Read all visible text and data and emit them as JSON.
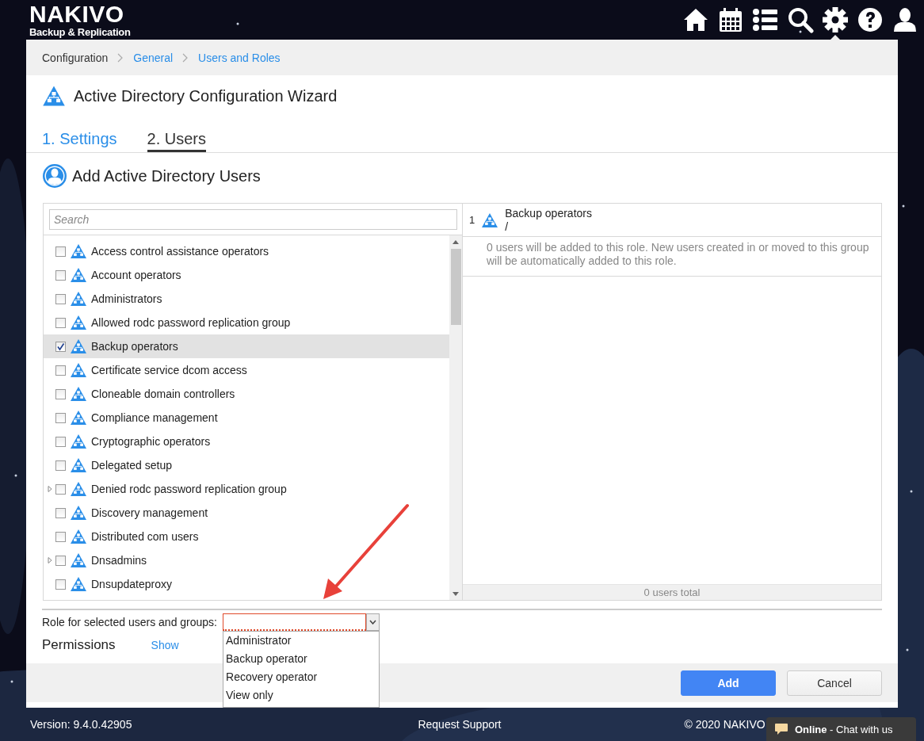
{
  "header": {
    "logo_title": "NAKIVO",
    "logo_subtitle": "Backup & Replication",
    "nav_icons": [
      {
        "kind": "home",
        "selected": false
      },
      {
        "kind": "calendar",
        "selected": false
      },
      {
        "kind": "list",
        "selected": false
      },
      {
        "kind": "search",
        "selected": false
      },
      {
        "kind": "settings",
        "selected": true
      },
      {
        "kind": "help",
        "selected": false
      },
      {
        "kind": "user",
        "selected": false
      }
    ]
  },
  "breadcrumbs": [
    "Configuration",
    "General",
    "Users and Roles"
  ],
  "wizard": {
    "title": "Active Directory Configuration Wizard",
    "steps": [
      {
        "label": "1. Settings",
        "selected": false
      },
      {
        "label": "2. Users",
        "selected": true
      }
    ],
    "section_title": "Add Active Directory Users"
  },
  "groups": {
    "search": {
      "placeholder": "Search"
    },
    "items": [
      {
        "label": "Access control assistance operators",
        "checked": false,
        "selected": false,
        "expandable": false
      },
      {
        "label": "Account operators",
        "checked": false,
        "selected": false,
        "expandable": false
      },
      {
        "label": "Administrators",
        "checked": false,
        "selected": false,
        "expandable": false
      },
      {
        "label": "Allowed rodc password replication group",
        "checked": false,
        "selected": false,
        "expandable": false
      },
      {
        "label": "Backup operators",
        "checked": true,
        "selected": true,
        "expandable": false
      },
      {
        "label": "Certificate service dcom access",
        "checked": false,
        "selected": false,
        "expandable": false
      },
      {
        "label": "Cloneable domain controllers",
        "checked": false,
        "selected": false,
        "expandable": false
      },
      {
        "label": "Compliance management",
        "checked": false,
        "selected": false,
        "expandable": false
      },
      {
        "label": "Cryptographic operators",
        "checked": false,
        "selected": false,
        "expandable": false
      },
      {
        "label": "Delegated setup",
        "checked": false,
        "selected": false,
        "expandable": false
      },
      {
        "label": "Denied rodc password replication group",
        "checked": false,
        "selected": false,
        "expandable": true
      },
      {
        "label": "Discovery management",
        "checked": false,
        "selected": false,
        "expandable": false
      },
      {
        "label": "Distributed com users",
        "checked": false,
        "selected": false,
        "expandable": false
      },
      {
        "label": "Dnsadmins",
        "checked": false,
        "selected": false,
        "expandable": true
      },
      {
        "label": "Dnsupdateproxy",
        "checked": false,
        "selected": false,
        "expandable": false
      }
    ]
  },
  "selected_groups": {
    "items": [
      {
        "index": "1",
        "name": "Backup operators",
        "path": "/",
        "note": "0 users will be added to this role. New users created in or moved to this group will be automatically added to this role."
      }
    ],
    "total": "0 users total"
  },
  "role": {
    "label": "Role for selected users and groups:",
    "expanded": true,
    "options": [
      "Administrator",
      "Backup operator",
      "Recovery operator",
      "View only"
    ]
  },
  "permissions": {
    "label": "Permissions",
    "link": "Show"
  },
  "buttons": [
    {
      "label": "Add",
      "kind": "primary"
    },
    {
      "label": "Cancel",
      "kind": "secondary"
    }
  ],
  "footer": {
    "version": "Version: 9.4.0.42905",
    "support": "Request Support",
    "copyright": "© 2020 NAKIVO"
  },
  "chat": {
    "status": "Online",
    "text": " - Chat with us"
  }
}
